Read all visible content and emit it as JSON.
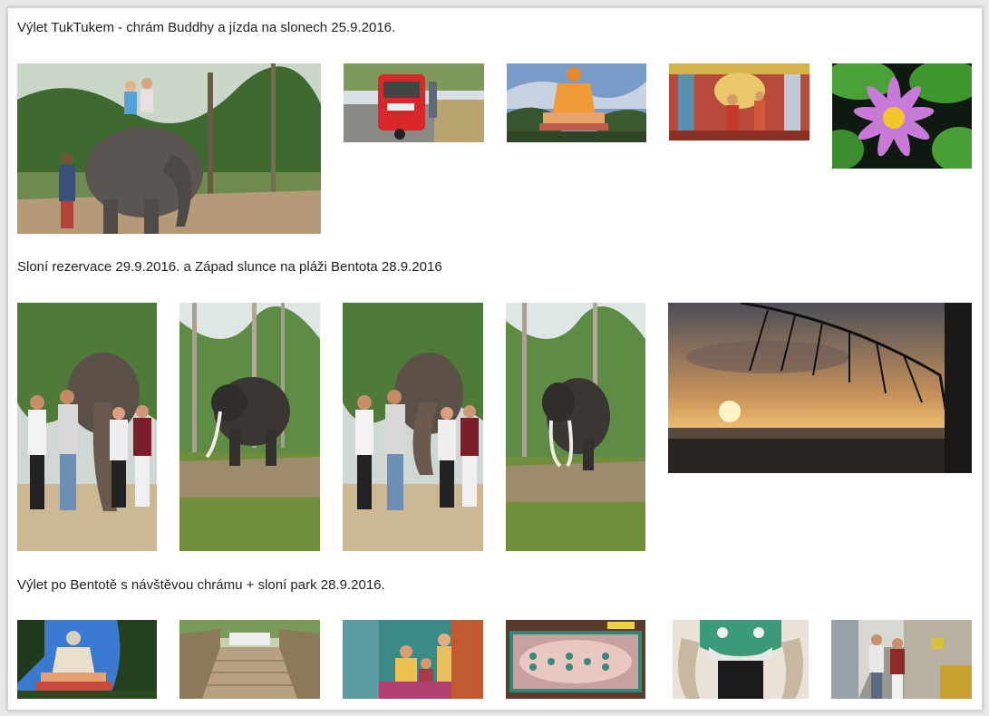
{
  "sections": [
    {
      "title": "Výlet TukTukem - chrám Buddhy a jízda na slonech 25.9.2016.",
      "photos": [
        "elephant-ride-photo",
        "tuktuk-photo",
        "buddha-statue-photo",
        "temple-interior-photo",
        "lotus-flower-photo"
      ]
    },
    {
      "title": "Sloní rezervace 29.9.2016. a Západ slunce na pláži Bentota 28.9.2016",
      "photos": [
        "group-with-elephant-photo",
        "elephant-tusks-photo",
        "group-with-elephant-photo-2",
        "elephant-tusks-photo-2",
        "sunset-beach-photo"
      ]
    },
    {
      "title": "Výlet po Bentotě s návštěvou chrámu + sloní park 28.9.2016.",
      "photos": [
        "buddha-statue-photo-2",
        "temple-stairs-photo",
        "temple-murals-photo",
        "buddha-footprint-photo",
        "temple-gate-demon-photo",
        "street-market-photo"
      ]
    }
  ]
}
